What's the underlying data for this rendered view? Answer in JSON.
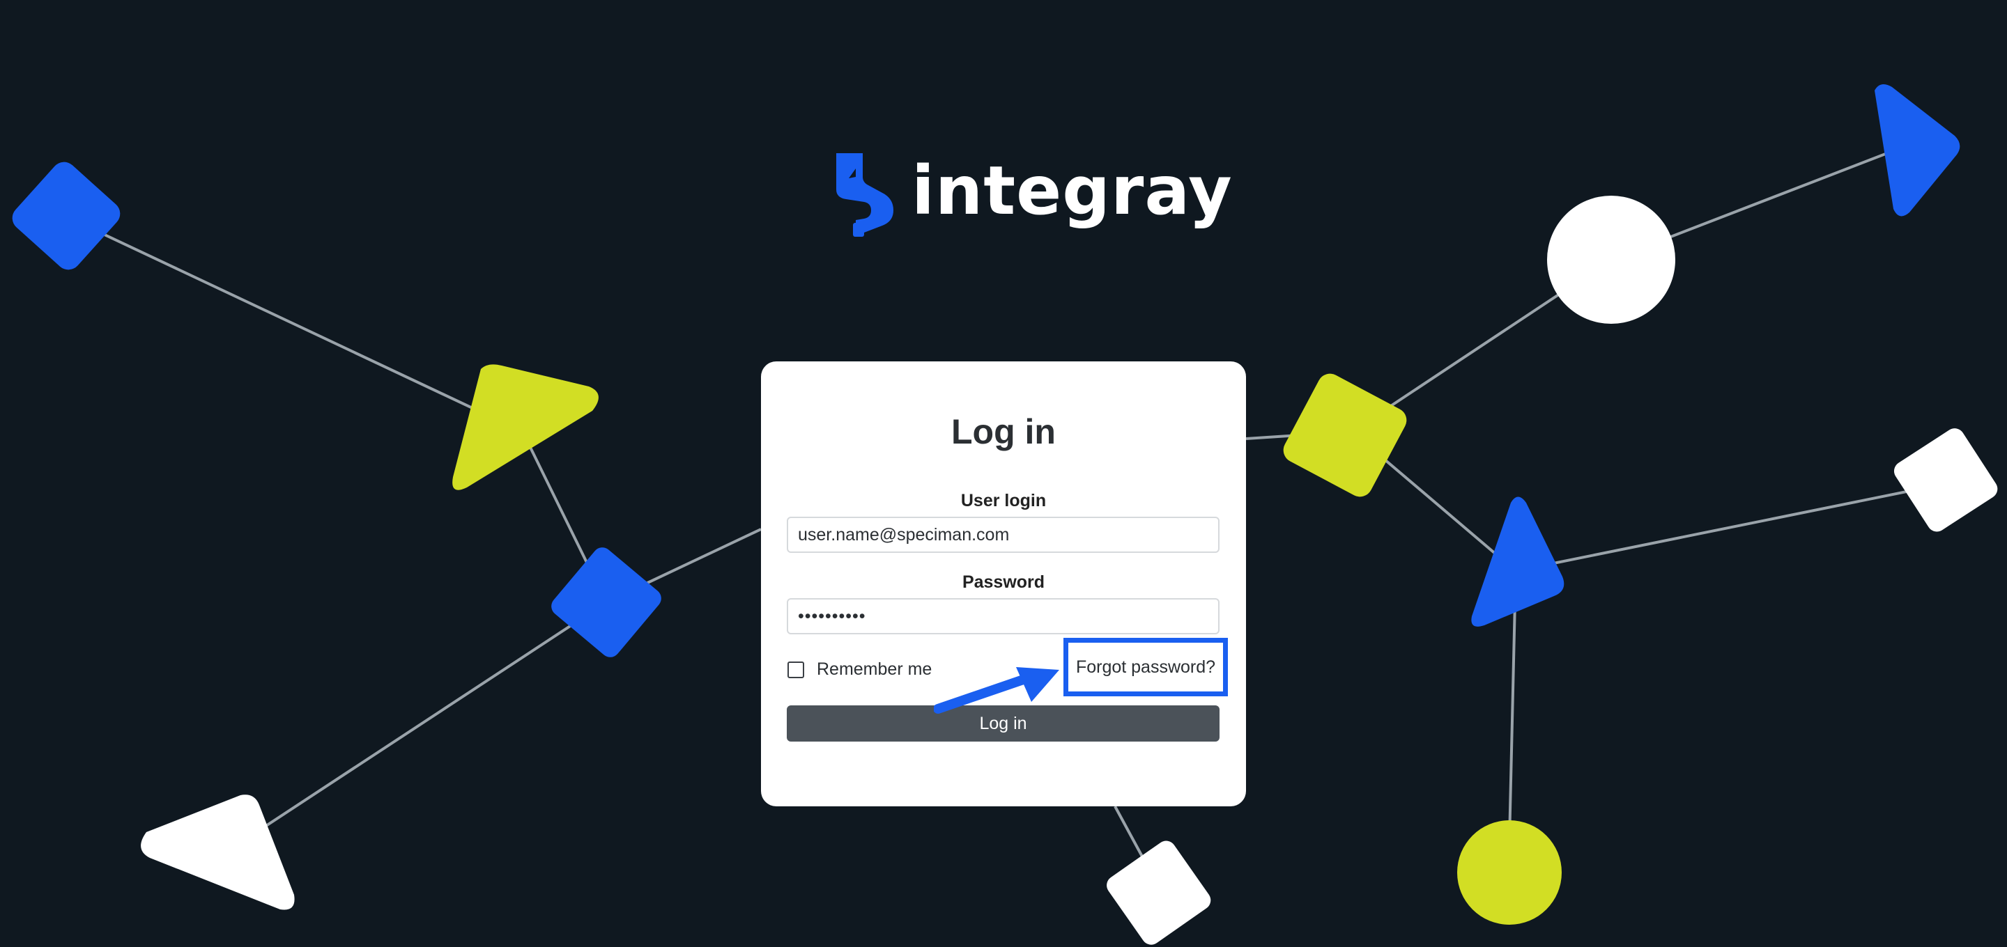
{
  "brand": {
    "name": "integray",
    "accent_color": "#1a5ff0",
    "lime_color": "#d2de24",
    "background_color": "#0f1820"
  },
  "login": {
    "title": "Log in",
    "user_label": "User login",
    "user_value": "user.name@speciman.com",
    "password_label": "Password",
    "password_value": "••••••••••",
    "remember_label": "Remember me",
    "remember_checked": false,
    "forgot_label": "Forgot password?",
    "submit_label": "Log in"
  },
  "annotation": {
    "highlight": "forgot-password",
    "color": "#1a5ff0"
  }
}
